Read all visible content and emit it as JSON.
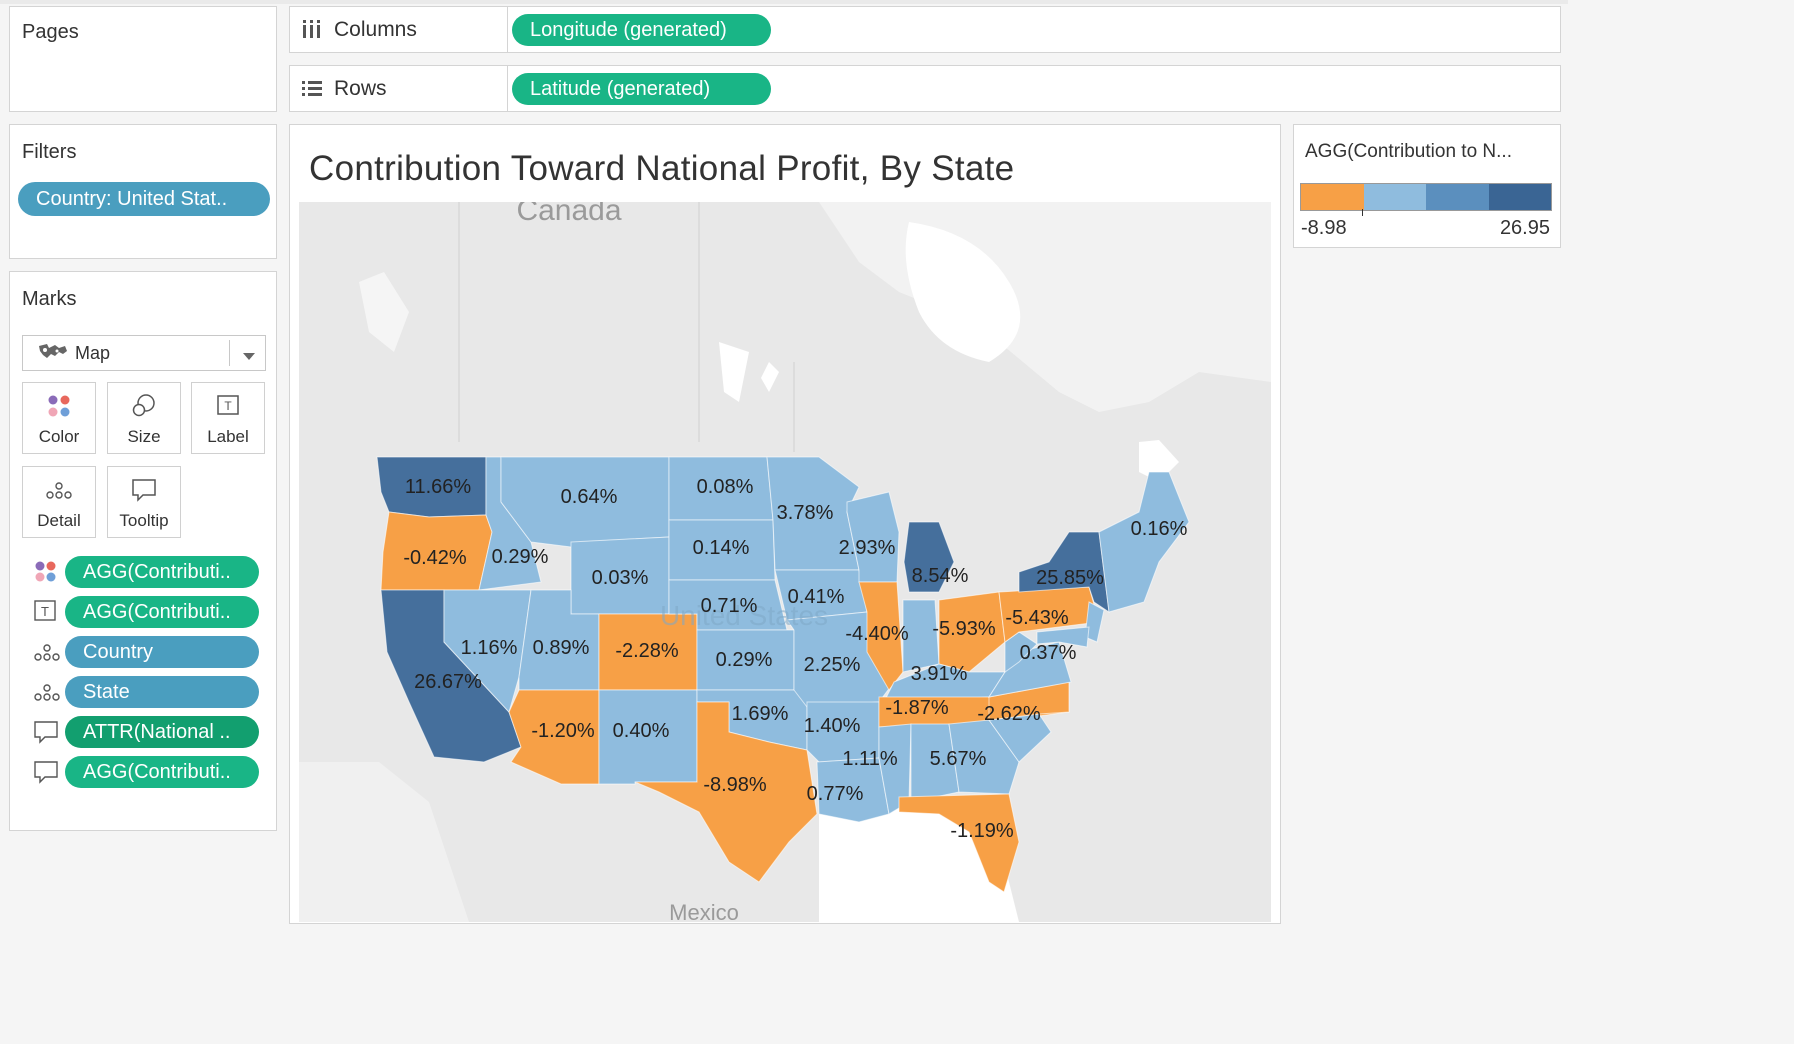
{
  "pages_shelf": {
    "title": "Pages"
  },
  "columns_shelf": {
    "label": "Columns",
    "pill": "Longitude (generated)"
  },
  "rows_shelf": {
    "label": "Rows",
    "pill": "Latitude (generated)"
  },
  "filters": {
    "title": "Filters",
    "pill": "Country: United Stat.."
  },
  "marks": {
    "title": "Marks",
    "mark_type": "Map",
    "cards": [
      {
        "label": "Color",
        "icon": "color-dots-icon"
      },
      {
        "label": "Size",
        "icon": "size-circles-icon"
      },
      {
        "label": "Label",
        "icon": "text-label-icon"
      },
      {
        "label": "Detail",
        "icon": "detail-dots-icon"
      },
      {
        "label": "Tooltip",
        "icon": "speech-bubble-icon"
      }
    ],
    "fields": [
      {
        "label": "AGG(Contributi..",
        "icon": "color-dots-icon",
        "color": "#19b586"
      },
      {
        "label": "AGG(Contributi..",
        "icon": "text-label-icon",
        "color": "#19b586"
      },
      {
        "label": "Country",
        "icon": "detail-dots-icon",
        "color": "#4a9ebf"
      },
      {
        "label": "State",
        "icon": "detail-dots-icon",
        "color": "#4a9ebf"
      },
      {
        "label": "ATTR(National ..",
        "icon": "speech-bubble-icon",
        "color": "#129f6f"
      },
      {
        "label": "AGG(Contributi..",
        "icon": "speech-bubble-icon",
        "color": "#19b586"
      }
    ]
  },
  "view": {
    "title": "Contribution Toward National Profit, By State",
    "map_labels": {
      "canada": "Canada",
      "us": "United States",
      "mexico": "Mexico"
    }
  },
  "legend": {
    "title": "AGG(Contribution to N...",
    "min": "-8.98",
    "max": "26.95",
    "colors": [
      "#f7a046",
      "#8fbcde",
      "#5b8fbe",
      "#3a6594"
    ]
  },
  "state_labels": [
    "11.66%",
    "0.64%",
    "0.08%",
    "3.78%",
    "-0.42%",
    "0.29%",
    "0.14%",
    "2.93%",
    "0.16%",
    "0.03%",
    "8.54%",
    "25.85%",
    "0.71%",
    "0.41%",
    "-5.43%",
    "-2.28%",
    "-4.40%",
    "-5.93%",
    "1.16%",
    "0.89%",
    "0.29%",
    "2.25%",
    "0.37%",
    "3.91%",
    "26.67%",
    "1.69%",
    "-1.87%",
    "-2.62%",
    "-1.20%",
    "0.40%",
    "1.40%",
    "1.11%",
    "5.67%",
    "-8.98%",
    "0.77%",
    "-1.19%"
  ],
  "colors": {
    "orange": "#f7a046",
    "light_blue": "#8fbcde",
    "mid_blue": "#5b8fbe",
    "dark_blue": "#456f9c"
  }
}
